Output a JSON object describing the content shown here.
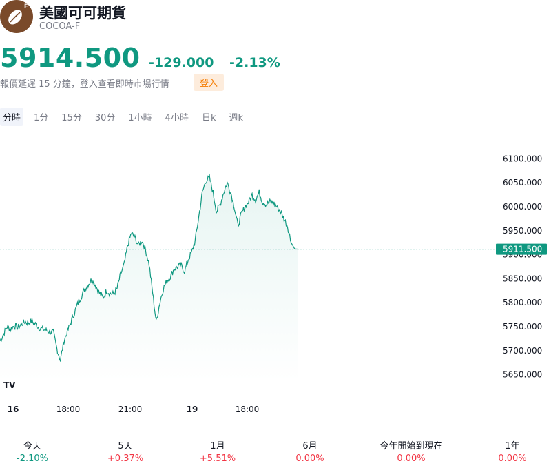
{
  "header": {
    "logo_badge": "F",
    "logo_icon": "cocoa-bean-icon",
    "title": "美國可可期貨",
    "ticker": "COCOA-F"
  },
  "quote": {
    "price": "5914.500",
    "change": "-129.000",
    "change_percent": "-2.13%",
    "delay_note": "報價延遲 15 分鐘，登入查看即時市場行情",
    "login_label": "登入",
    "color_down": "#0f9880",
    "color_up": "#f23645"
  },
  "tabs": [
    {
      "label": "分時",
      "active": true
    },
    {
      "label": "1分"
    },
    {
      "label": "15分"
    },
    {
      "label": "30分"
    },
    {
      "label": "1小時"
    },
    {
      "label": "4小時"
    },
    {
      "label": "日k"
    },
    {
      "label": "週k"
    }
  ],
  "chart_data": {
    "type": "area",
    "ylim": [
      5635,
      6115
    ],
    "y_ticks": [
      "6100.000",
      "6050.000",
      "6000.000",
      "5950.000",
      "5900.000",
      "5850.000",
      "5800.000",
      "5750.000",
      "5700.000",
      "5650.000"
    ],
    "x_tick_labels": [
      "16",
      "18:00",
      "21:00",
      "19",
      "18:00"
    ],
    "current_price_label": "5911.500",
    "current_price": 5911.5,
    "series": [
      {
        "values": [
          5720,
          5735,
          5750,
          5745,
          5752,
          5748,
          5755,
          5760,
          5758,
          5762,
          5755,
          5748,
          5745,
          5742,
          5740,
          5738,
          5705,
          5680,
          5720,
          5740,
          5760,
          5780,
          5800,
          5815,
          5830,
          5840,
          5850,
          5835,
          5820,
          5810,
          5825,
          5820,
          5818,
          5830,
          5860,
          5880,
          5920,
          5945,
          5935,
          5920,
          5930,
          5910,
          5880,
          5820,
          5760,
          5800,
          5830,
          5845,
          5855,
          5870,
          5875,
          5878,
          5865,
          5890,
          5905,
          5930,
          5980,
          6030,
          6055,
          6060,
          6030,
          5990,
          6005,
          6030,
          6050,
          6030,
          6000,
          5960,
          5985,
          6000,
          6010,
          6025,
          6015,
          6030,
          6010,
          6005,
          6010,
          6008,
          6000,
          5990,
          5975,
          5960,
          5925,
          5912,
          5911.5
        ],
        "color": "#0f9880"
      }
    ]
  },
  "performance": [
    {
      "label": "今天",
      "value": "-2.10%",
      "dir": "neg"
    },
    {
      "label": "5天",
      "value": "+0.37%",
      "dir": "pos"
    },
    {
      "label": "1月",
      "value": "+5.51%",
      "dir": "pos"
    },
    {
      "label": "6月",
      "value": "0.00%",
      "dir": "pos"
    },
    {
      "label": "今年開始到現在",
      "value": "0.00%",
      "dir": "pos"
    },
    {
      "label": "1年",
      "value": "0.00%",
      "dir": "pos"
    }
  ],
  "watermark": "TV"
}
